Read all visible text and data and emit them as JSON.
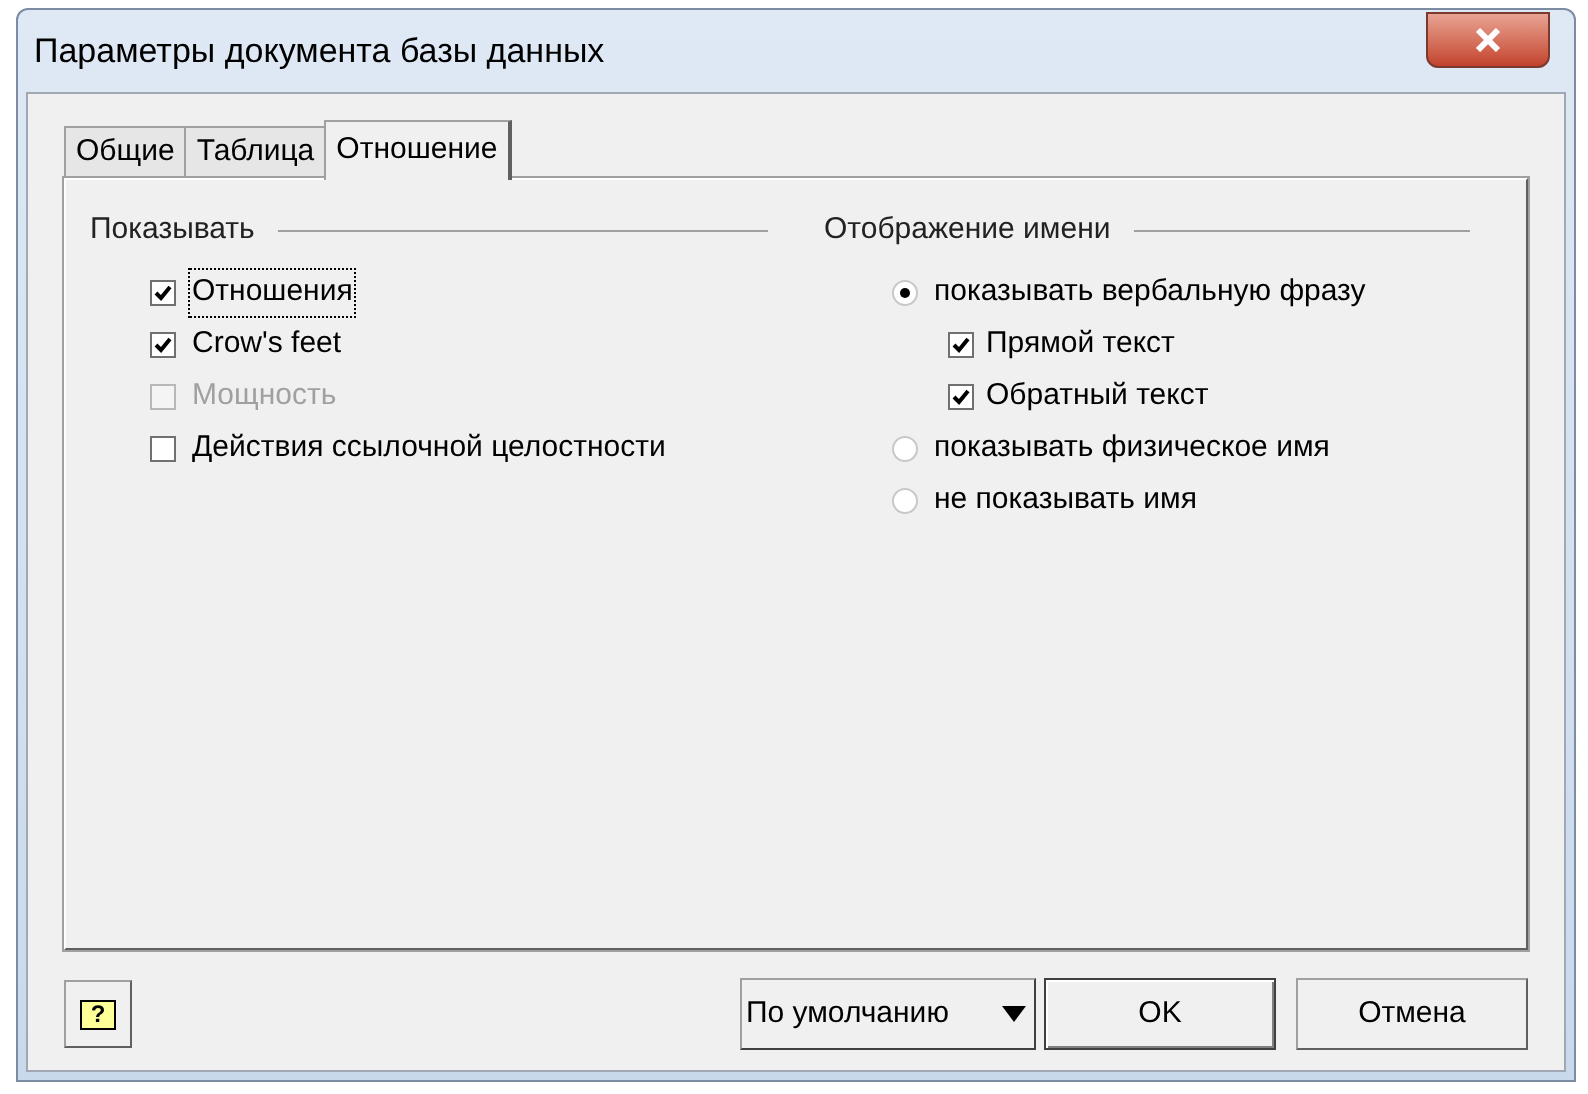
{
  "window": {
    "title": "Параметры документа базы данных"
  },
  "tabs": [
    {
      "label": "Общие",
      "selected": false
    },
    {
      "label": "Таблица",
      "selected": false
    },
    {
      "label": "Отношение",
      "selected": true
    }
  ],
  "show_group": {
    "title": "Показывать",
    "items": [
      {
        "label": "Отношения",
        "checked": true,
        "disabled": false,
        "focused": true
      },
      {
        "label": "Crow's feet",
        "checked": true,
        "disabled": false,
        "focused": false
      },
      {
        "label": "Мощность",
        "checked": false,
        "disabled": true,
        "focused": false
      },
      {
        "label": "Действия ссылочной целостности",
        "checked": false,
        "disabled": false,
        "focused": false
      }
    ]
  },
  "name_group": {
    "title": "Отображение имени",
    "options": [
      {
        "label": "показывать вербальную фразу",
        "selected": true,
        "children": [
          {
            "label": "Прямой текст",
            "checked": true
          },
          {
            "label": "Обратный текст",
            "checked": true
          }
        ]
      },
      {
        "label": "показывать физическое имя",
        "selected": false
      },
      {
        "label": "не показывать имя",
        "selected": false
      }
    ]
  },
  "buttons": {
    "help": "?",
    "default": "По умолчанию",
    "ok": "OK",
    "cancel": "Отмена"
  }
}
